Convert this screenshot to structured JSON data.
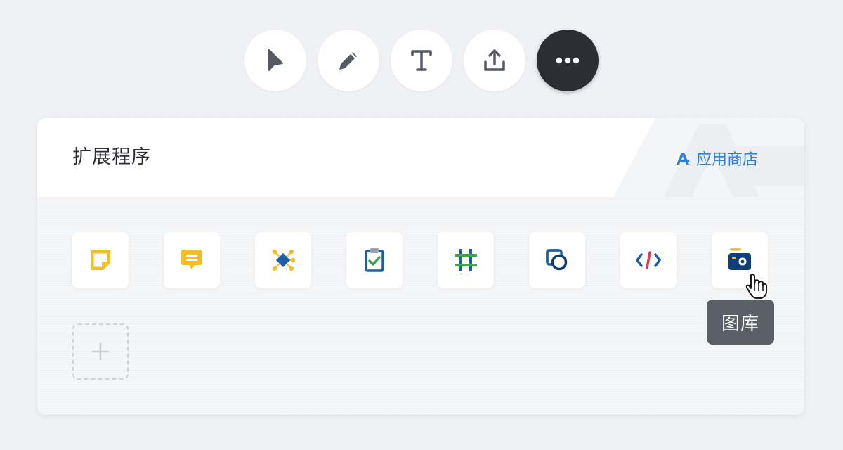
{
  "toolbar": {
    "tools": [
      {
        "name": "select",
        "icon": "cursor-arrow-icon"
      },
      {
        "name": "pen",
        "icon": "pencil-icon"
      },
      {
        "name": "text",
        "icon": "text-icon"
      },
      {
        "name": "share",
        "icon": "upload-icon"
      },
      {
        "name": "more",
        "icon": "more-dots-icon",
        "active": true
      }
    ]
  },
  "panel": {
    "title": "扩展程序",
    "app_store_label": "应用商店",
    "apps": [
      {
        "icon": "sticky-note-icon",
        "color": "#f6bd23"
      },
      {
        "icon": "comment-icon",
        "color": "#f6bd23"
      },
      {
        "icon": "mind-map-icon",
        "color": "#1c5ea8"
      },
      {
        "icon": "clipboard-check-icon",
        "color": "#1c5ea8"
      },
      {
        "icon": "crop-frame-icon",
        "color": "#1c5ea8"
      },
      {
        "icon": "shape-icon",
        "color": "#1c5ea8"
      },
      {
        "icon": "code-embed-icon",
        "color": "#1c5ea8"
      },
      {
        "icon": "photo-library-icon",
        "color": "#0f3f78"
      }
    ],
    "add_icon": "plus-icon"
  },
  "tooltip": {
    "text": "图库"
  },
  "colors": {
    "accent": "#2f7fd6",
    "dark_button": "#2b2e35",
    "yellow": "#f6bd23",
    "navy": "#1c5ea8",
    "green": "#3aa84a",
    "red": "#e23b4f"
  }
}
